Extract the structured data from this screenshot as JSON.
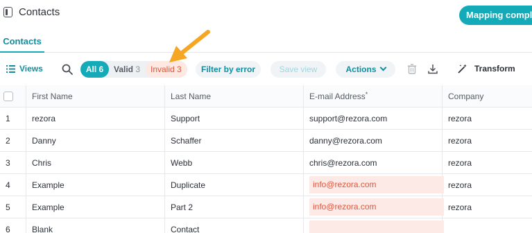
{
  "header": {
    "title": "Contacts",
    "mapping_button": "Mapping complete"
  },
  "tabs": [
    {
      "label": "Contacts"
    }
  ],
  "toolbar": {
    "views": "Views",
    "filters": {
      "all": {
        "label": "All",
        "count": "6"
      },
      "valid": {
        "label": "Valid",
        "count": "3"
      },
      "invalid": {
        "label": "Invalid",
        "count": "3"
      }
    },
    "filter_by_error": "Filter by error",
    "save_view": "Save view",
    "actions": "Actions",
    "transform": "Transform"
  },
  "table": {
    "columns": [
      "First Name",
      "Last Name",
      "E-mail Address",
      "Company"
    ],
    "required_marker": "*",
    "rows": [
      {
        "num": "1",
        "first": "rezora",
        "last": "Support",
        "email": "support@rezora.com",
        "company": "rezora",
        "email_error": false
      },
      {
        "num": "2",
        "first": "Danny",
        "last": "Schaffer",
        "email": "danny@rezora.com",
        "company": "rezora",
        "email_error": false
      },
      {
        "num": "3",
        "first": "Chris",
        "last": "Webb",
        "email": "chris@rezora.com",
        "company": "rezora",
        "email_error": false
      },
      {
        "num": "4",
        "first": "Example",
        "last": "Duplicate",
        "email": "info@rezora.com",
        "company": "rezora",
        "email_error": true
      },
      {
        "num": "5",
        "first": "Example",
        "last": "Part 2",
        "email": "info@rezora.com",
        "company": "rezora",
        "email_error": true
      },
      {
        "num": "6",
        "first": "Blank",
        "last": "Contact",
        "email": "",
        "company": "",
        "email_error": true
      }
    ]
  },
  "colors": {
    "accent": "#14aab8",
    "error_bg": "#fde9e6",
    "error_text": "#e0563a",
    "arrow": "#f5a623"
  }
}
